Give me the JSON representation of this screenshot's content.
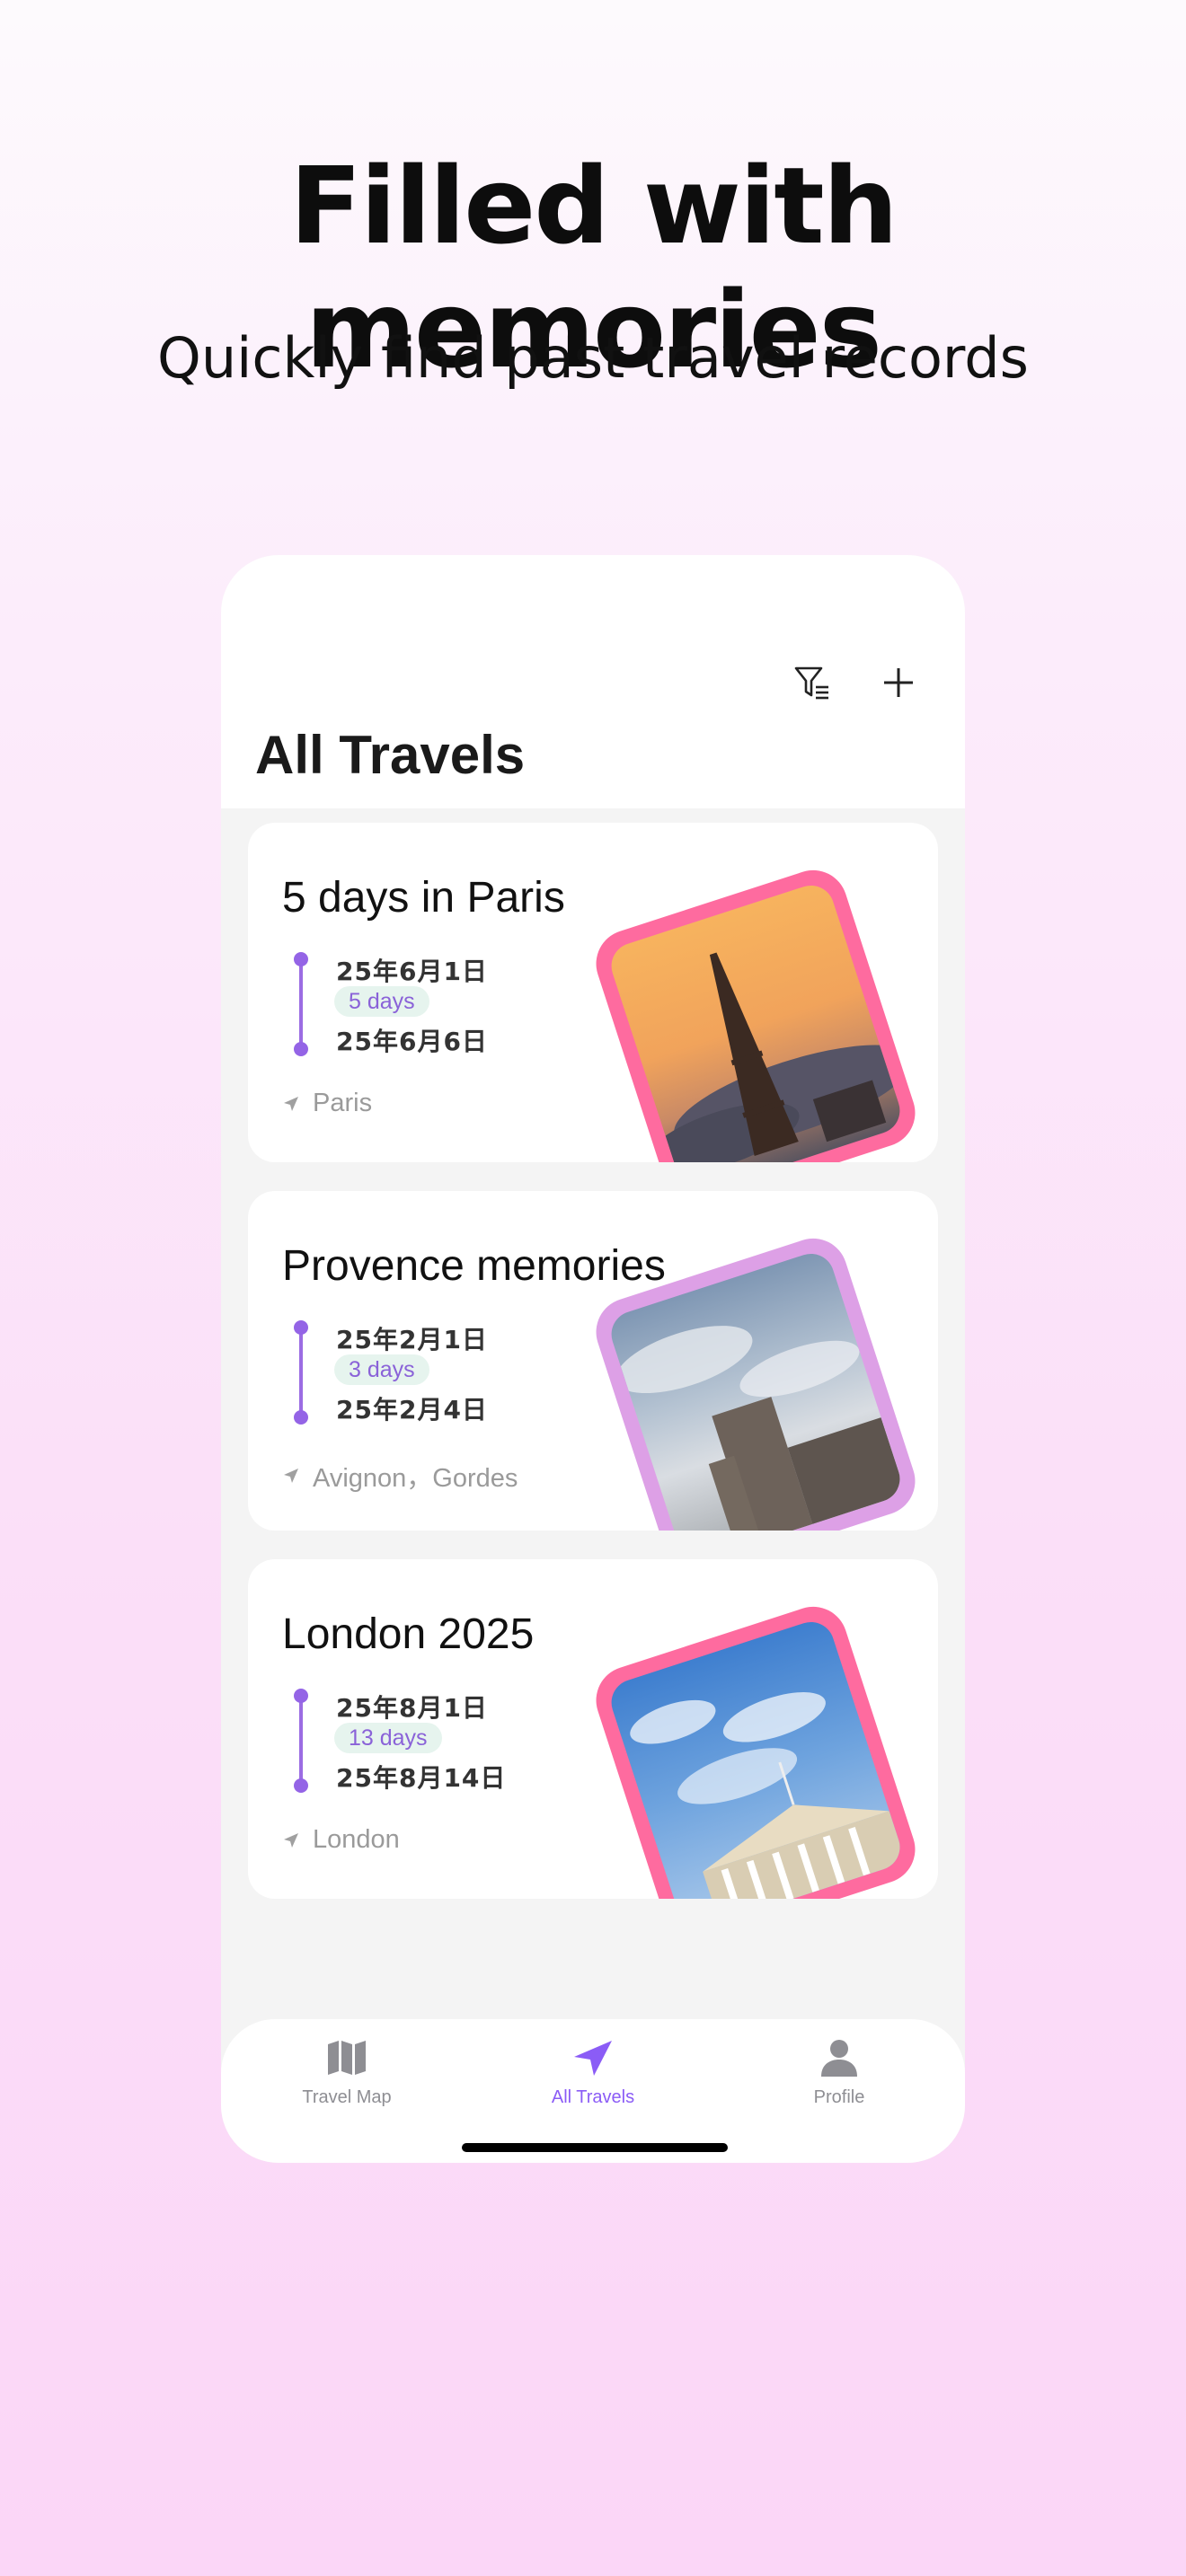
{
  "hero": {
    "title": "Filled with memories",
    "subtitle": "Quickly find past travel records"
  },
  "app": {
    "nav_title": "All Travels",
    "filter_icon": "filter-icon",
    "add_icon": "plus-icon",
    "accent_color": "#8b5cf6"
  },
  "travels": [
    {
      "title": "5 days in Paris",
      "start_date": "25年6月1日",
      "duration": "5 days",
      "end_date": "25年6月6日",
      "location": "Paris",
      "frame_color": "#fe6b9f",
      "photo": "eiffel-tower-sunset"
    },
    {
      "title": "Provence memories",
      "start_date": "25年2月1日",
      "duration": "3 days",
      "end_date": "25年2月4日",
      "location": "Avignon，Gordes",
      "frame_color": "#dda0e6",
      "photo": "stone-castle-cloudy-sky"
    },
    {
      "title": "London 2025",
      "start_date": "25年8月1日",
      "duration": "13 days",
      "end_date": "25年8月14日",
      "location": "London",
      "frame_color": "#fe6b9f",
      "photo": "british-museum-blue-sky"
    }
  ],
  "tabbar": {
    "tabs": [
      {
        "label": "Travel Map",
        "icon": "map-icon",
        "active": false
      },
      {
        "label": "All Travels",
        "icon": "location-arrow-icon",
        "active": true
      },
      {
        "label": "Profile",
        "icon": "person-icon",
        "active": false
      }
    ]
  }
}
